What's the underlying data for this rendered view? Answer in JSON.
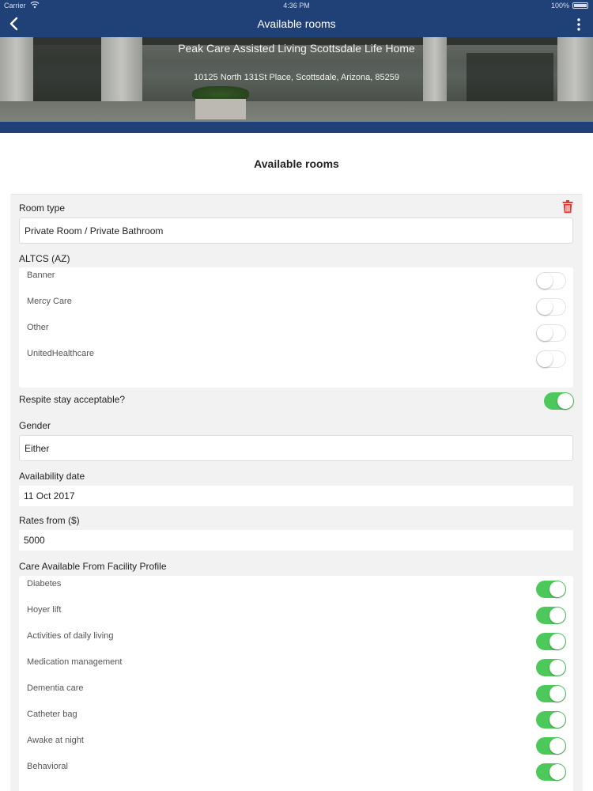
{
  "status_bar": {
    "carrier": "Carrier",
    "time": "4:36 PM",
    "battery": "100%"
  },
  "nav": {
    "title": "Available rooms",
    "back_icon": "chevron-left-icon",
    "menu_icon": "more-vertical-icon"
  },
  "facility": {
    "name": "Peak Care Assisted Living Scottsdale Life Home",
    "address": "10125 North 131St Place, Scottsdale, Arizona, 85259"
  },
  "section_title": "Available rooms",
  "room": {
    "room_type_label": "Room type",
    "room_type_value": "Private Room / Private Bathroom",
    "delete_icon": "trash-icon",
    "altcs_label": "ALTCS (AZ)",
    "altcs_options": [
      {
        "label": "Banner",
        "enabled": false
      },
      {
        "label": "Mercy Care",
        "enabled": false
      },
      {
        "label": "Other",
        "enabled": false
      },
      {
        "label": "UnitedHealthcare",
        "enabled": false
      }
    ],
    "respite_label": "Respite stay acceptable?",
    "respite_enabled": true,
    "gender_label": "Gender",
    "gender_value": "Either",
    "availability_label": "Availability date",
    "availability_value": "11 Oct 2017",
    "rates_label": "Rates from ($)",
    "rates_value": "5000",
    "care_label": "Care Available From Facility Profile",
    "care_options": [
      {
        "label": "Diabetes",
        "enabled": true
      },
      {
        "label": "Hoyer lift",
        "enabled": true
      },
      {
        "label": "Activities of daily living",
        "enabled": true
      },
      {
        "label": "Medication management",
        "enabled": true
      },
      {
        "label": "Dementia care",
        "enabled": true
      },
      {
        "label": "Catheter bag",
        "enabled": true
      },
      {
        "label": "Awake at night",
        "enabled": true
      },
      {
        "label": "Behavioral",
        "enabled": true
      }
    ]
  },
  "colors": {
    "nav_bg": "#1f4177",
    "toggle_on": "#4cc95a",
    "delete": "#e53935",
    "card_bg": "#f2f2f2"
  }
}
